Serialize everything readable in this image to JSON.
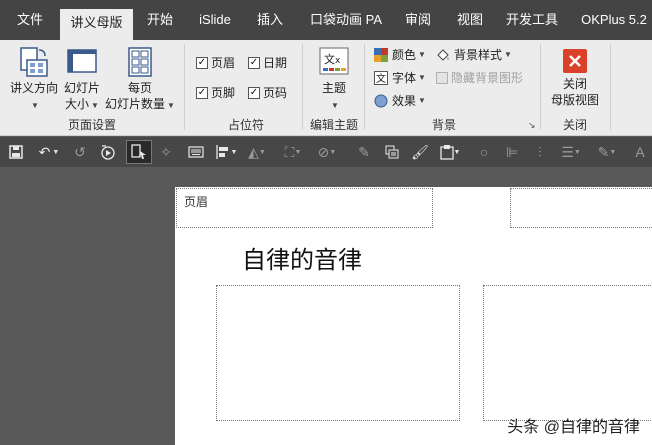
{
  "tabs": [
    {
      "label": "文件"
    },
    {
      "label": "讲义母版"
    },
    {
      "label": "开始"
    },
    {
      "label": "iSlide"
    },
    {
      "label": "插入"
    },
    {
      "label": "口袋动画 PA"
    },
    {
      "label": "审阅"
    },
    {
      "label": "视图"
    },
    {
      "label": "开发工具"
    },
    {
      "label": "OKPlus 5.2"
    }
  ],
  "ribbon": {
    "page_setup": {
      "group_label": "页面设置",
      "orientation_l1": "讲义方向",
      "slide_size_l1": "幻灯片",
      "slide_size_l2": "大小",
      "per_page_l1": "每页",
      "per_page_l2": "幻灯片数量"
    },
    "placeholders": {
      "group_label": "占位符",
      "header": "页眉",
      "date": "日期",
      "footer": "页脚",
      "page_number": "页码"
    },
    "edit_theme": {
      "group_label": "编辑主题",
      "theme": "主题"
    },
    "background": {
      "group_label": "背景",
      "colors": "颜色",
      "fonts": "字体",
      "effects": "效果",
      "background_styles": "背景样式",
      "hide_background": "隐藏背景图形"
    },
    "close": {
      "group_label": "关闭",
      "close_l1": "关闭",
      "close_l2": "母版视图"
    }
  },
  "slide": {
    "header_placeholder": "页眉",
    "title": "自律的音律",
    "watermark": "头条 @自律的音律"
  },
  "colors": {
    "tabbar": "#444444",
    "ribbon": "#ececec",
    "workspace": "#595959",
    "close_red": "#d9412b"
  }
}
